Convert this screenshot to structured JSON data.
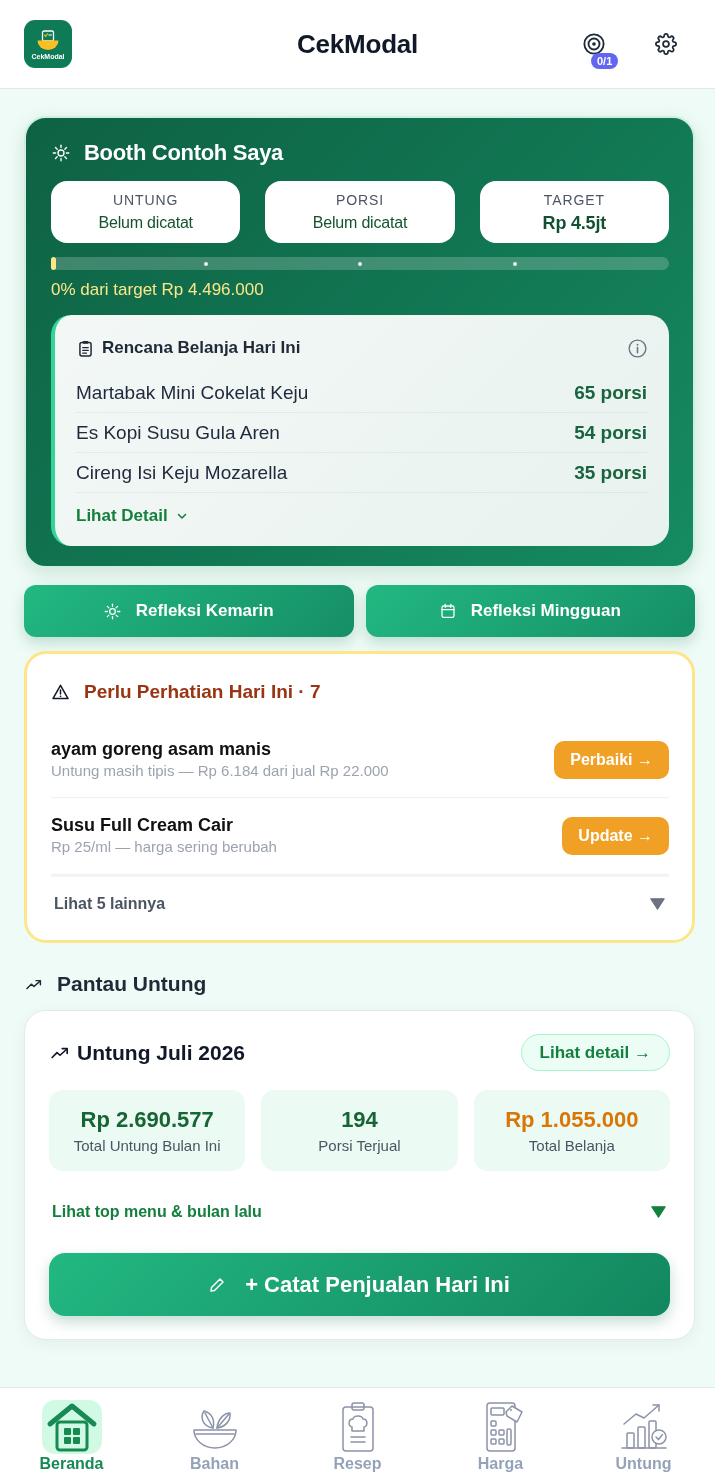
{
  "header": {
    "logo_text": "CekModal",
    "title": "CekModal",
    "goal_badge": "0/1"
  },
  "booth": {
    "title": "Booth Contoh Saya",
    "stats": [
      {
        "label": "UNTUNG",
        "value": "Belum dicatat",
        "kind": "empty"
      },
      {
        "label": "PORSI",
        "value": "Belum dicatat",
        "kind": "empty"
      },
      {
        "label": "TARGET",
        "value": "Rp 4.5jt",
        "kind": "amount"
      }
    ],
    "progress": {
      "level": 0,
      "text": "0% dari target Rp 4.496.000"
    },
    "plan": {
      "title": "Rencana Belanja Hari Ini",
      "items": [
        {
          "name": "Martabak Mini Cokelat Keju",
          "qty": "65 porsi"
        },
        {
          "name": "Es Kopi Susu Gula Aren",
          "qty": "54 porsi"
        },
        {
          "name": "Cireng Isi Keju Mozarella",
          "qty": "35 porsi"
        }
      ],
      "detail_link": "Lihat Detail"
    }
  },
  "reflection_buttons": [
    {
      "label": "Refleksi Kemarin",
      "kind": "daily"
    },
    {
      "label": "Refleksi Mingguan",
      "kind": "weekly"
    }
  ],
  "attention": {
    "title": "Perlu Perhatian Hari Ini · 7",
    "items": [
      {
        "name": "ayam goreng asam manis",
        "note": "Untung masih tipis — Rp 6.184 dari jual Rp 22.000",
        "action": "Perbaiki →"
      },
      {
        "name": "Susu Full Cream Cair",
        "note": "Rp 25/ml — harga sering berubah",
        "action": "Update →"
      }
    ],
    "more": "Lihat 5 lainnya"
  },
  "profit": {
    "section_title": "Pantau Untung",
    "title": "Untung Juli 2026",
    "detail_button": "Lihat detail →",
    "stats": [
      {
        "value": "Rp 2.690.577",
        "label": "Total Untung Bulan Ini",
        "kind": "gain"
      },
      {
        "value": "194",
        "label": "Porsi Terjual",
        "kind": "gain"
      },
      {
        "value": "Rp 1.055.000",
        "label": "Total Belanja",
        "kind": "cost"
      }
    ],
    "more": "Lihat top menu & bulan lalu",
    "record_button": "+ Catat Penjualan Hari Ini"
  },
  "nav": [
    {
      "label": "Beranda",
      "kind": "home",
      "selected": true
    },
    {
      "label": "Bahan",
      "kind": "ingredients",
      "selected": false
    },
    {
      "label": "Resep",
      "kind": "recipe",
      "selected": false
    },
    {
      "label": "Harga",
      "kind": "price",
      "selected": false
    },
    {
      "label": "Untung",
      "kind": "profit",
      "selected": false
    }
  ]
}
